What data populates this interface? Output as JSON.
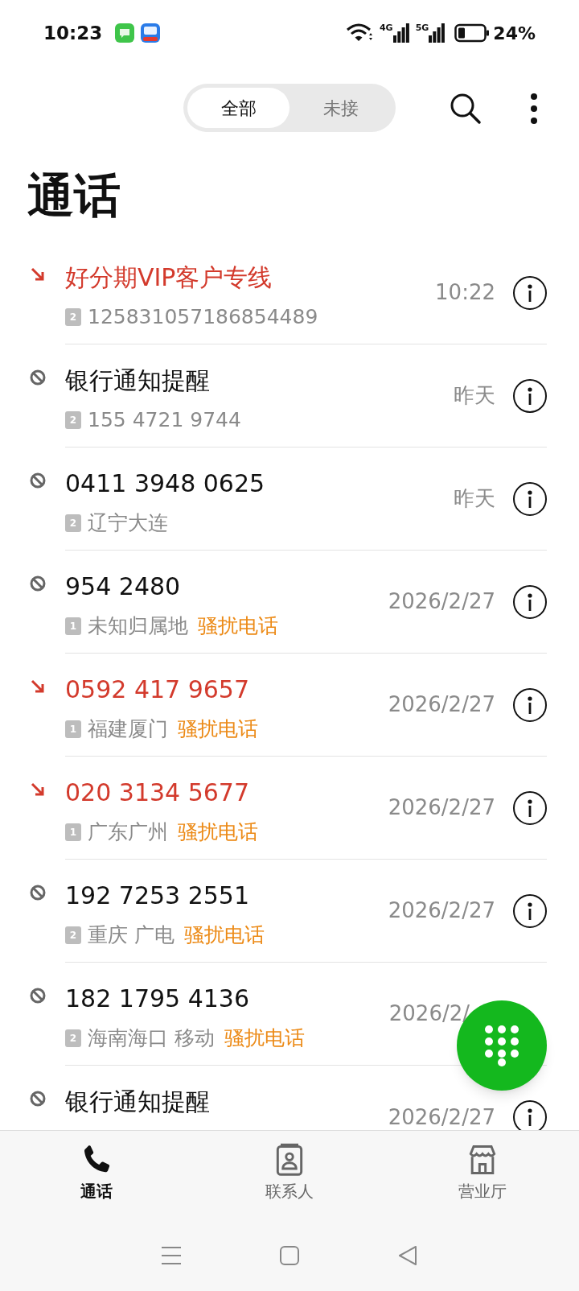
{
  "status_bar": {
    "time": "10:23",
    "network_1": "4G",
    "network_2": "5G",
    "battery": "24%"
  },
  "filter_tabs": [
    {
      "label": "全部",
      "selected": true
    },
    {
      "label": "未接",
      "selected": false
    }
  ],
  "title": "通话",
  "calls": [
    {
      "kind": "missed",
      "name": "好分期VIP客户专线",
      "sim": "2",
      "detail": "125831057186854489",
      "time": "10:22"
    },
    {
      "kind": "blocked",
      "name": "银行通知提醒",
      "sim": "2",
      "detail": "155 4721 9744",
      "time": "昨天"
    },
    {
      "kind": "blocked",
      "name": "0411 3948 0625",
      "sim": "2",
      "detail": "辽宁大连",
      "time": "昨天"
    },
    {
      "kind": "blocked",
      "name": "954 2480",
      "sim": "1",
      "detail": "未知归属地",
      "tag": "骚扰电话",
      "time": "2026/2/27"
    },
    {
      "kind": "missed",
      "name": "0592 417 9657",
      "sim": "1",
      "detail": "福建厦门",
      "tag": "骚扰电话",
      "time": "2026/2/27"
    },
    {
      "kind": "missed",
      "name": "020 3134 5677",
      "sim": "1",
      "detail": "广东广州",
      "tag": "骚扰电话",
      "time": "2026/2/27"
    },
    {
      "kind": "blocked",
      "name": "192 7253 2551",
      "sim": "2",
      "detail": "重庆 广电",
      "tag": "骚扰电话",
      "time": "2026/2/27"
    },
    {
      "kind": "blocked",
      "name": "182 1795 4136",
      "sim": "2",
      "detail": "海南海口 移动",
      "tag": "骚扰电话",
      "time": "2026/2/",
      "info_visible": false
    },
    {
      "kind": "blocked",
      "name": "银行通知提醒",
      "time": "2026/2/27"
    }
  ],
  "bottom_nav": [
    {
      "label": "通话",
      "kind": "phone",
      "selected": true
    },
    {
      "label": "联系人",
      "kind": "contacts",
      "selected": false
    },
    {
      "label": "营业厅",
      "kind": "store",
      "selected": false
    }
  ]
}
